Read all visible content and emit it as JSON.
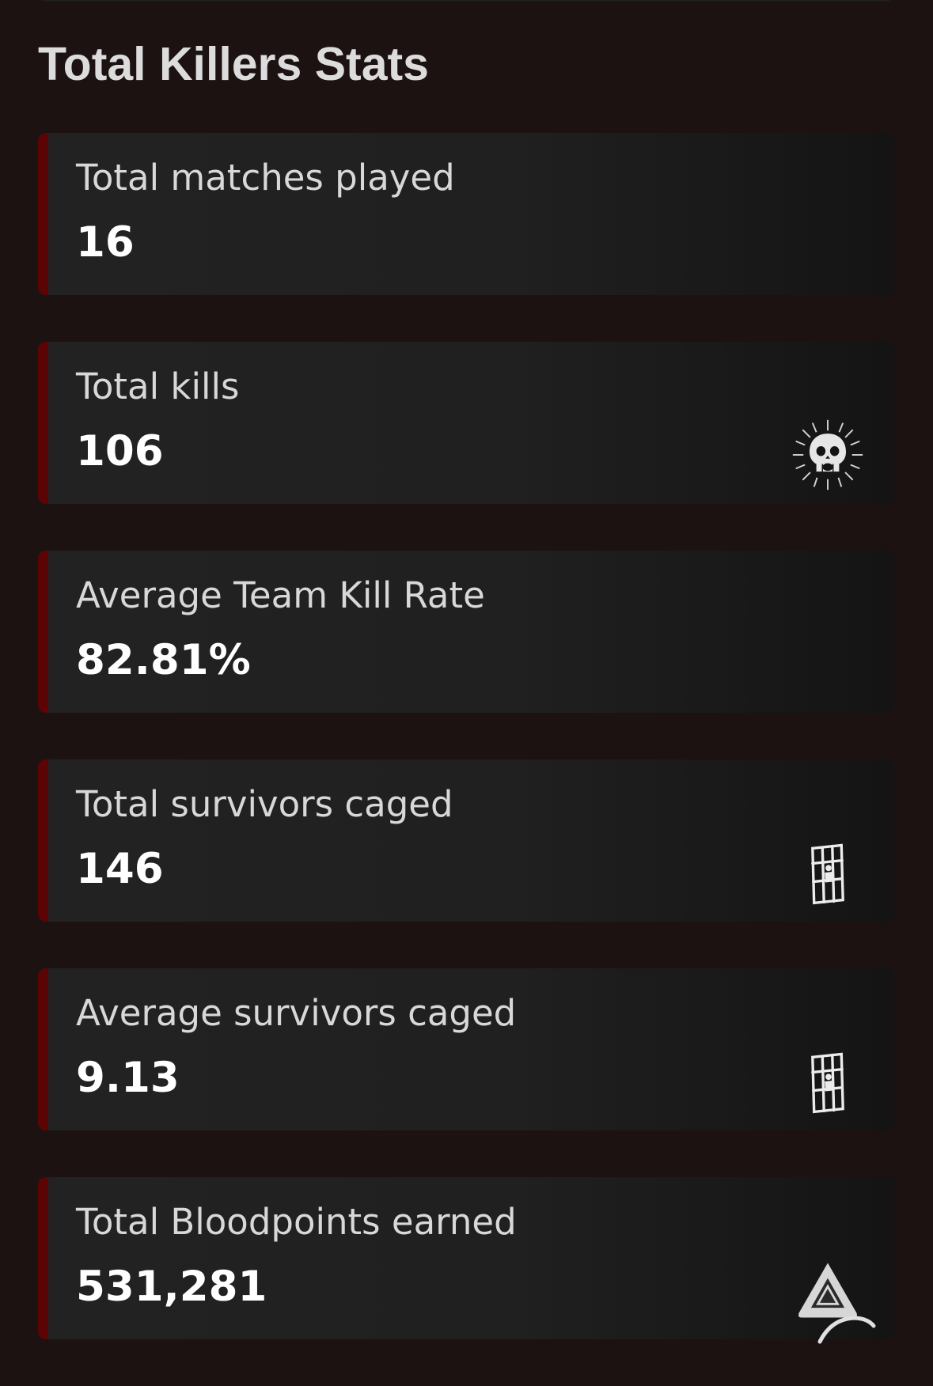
{
  "section": {
    "title": "Total Killers Stats"
  },
  "stats": [
    {
      "label": "Total matches played",
      "value": "16",
      "icon": ""
    },
    {
      "label": "Total kills",
      "value": "106",
      "icon": "skull-icon"
    },
    {
      "label": "Average Team Kill Rate",
      "value": "82.81%",
      "icon": ""
    },
    {
      "label": "Total survivors caged",
      "value": "146",
      "icon": "cage-icon"
    },
    {
      "label": "Average survivors caged",
      "value": "9.13",
      "icon": "cage-icon"
    },
    {
      "label": "Total Bloodpoints earned",
      "value": "531,281",
      "icon": "bloodpoints-icon"
    }
  ],
  "colors": {
    "background": "#1b1211",
    "card": "#212121",
    "accent": "#5c0404",
    "title": "#dcdcdc",
    "label": "#d8d8d8",
    "value": "#ffffff"
  }
}
